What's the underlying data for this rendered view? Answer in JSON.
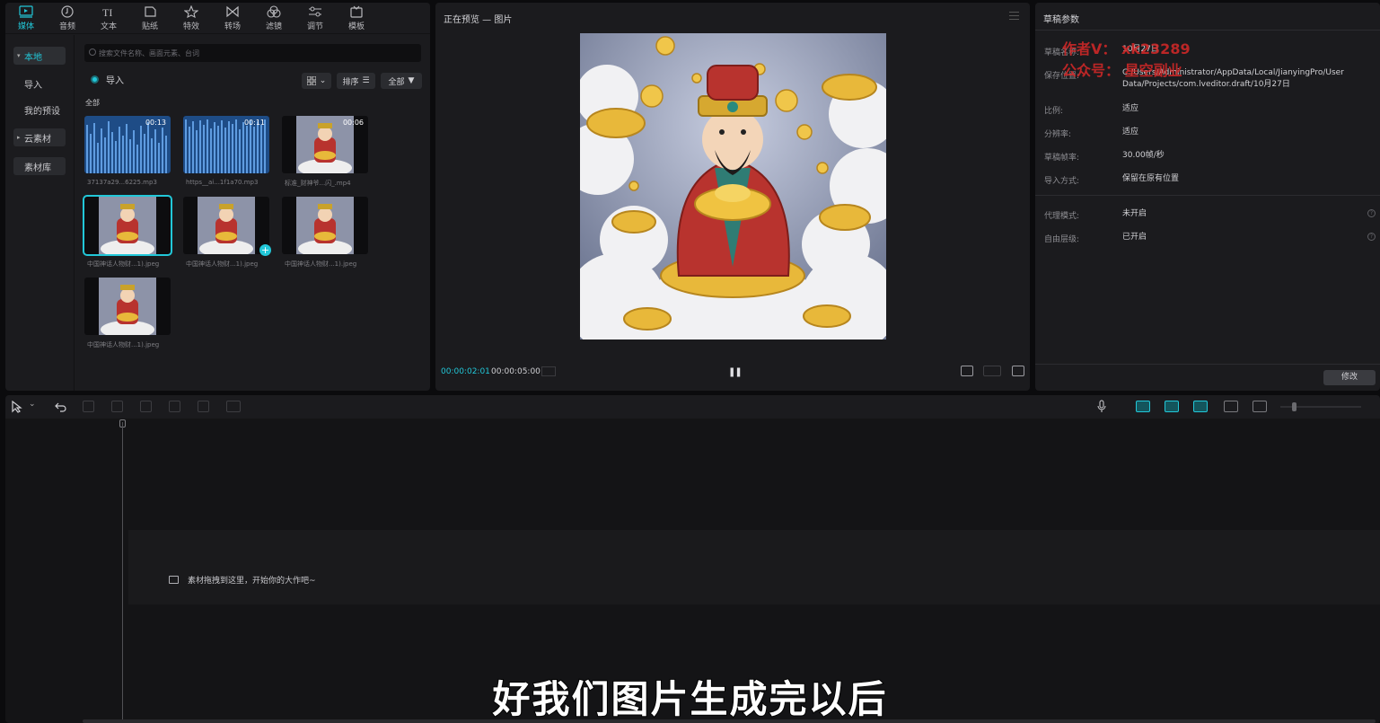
{
  "toolbar": {
    "tabs": [
      {
        "label": "媒体",
        "icon": "media-icon",
        "active": true
      },
      {
        "label": "音频",
        "icon": "audio-icon",
        "active": false
      },
      {
        "label": "文本",
        "icon": "text-icon",
        "active": false
      },
      {
        "label": "贴纸",
        "icon": "sticker-icon",
        "active": false
      },
      {
        "label": "特效",
        "icon": "effects-icon",
        "active": false
      },
      {
        "label": "转场",
        "icon": "transition-icon",
        "active": false
      },
      {
        "label": "滤镜",
        "icon": "filter-icon",
        "active": false
      },
      {
        "label": "调节",
        "icon": "adjust-icon",
        "active": false
      },
      {
        "label": "模板",
        "icon": "template-icon",
        "active": false
      }
    ]
  },
  "sidebar": {
    "items": [
      {
        "label": "本地"
      },
      {
        "label": "导入"
      },
      {
        "label": "我的预设"
      },
      {
        "label": "云素材"
      },
      {
        "label": "素材库"
      }
    ]
  },
  "media": {
    "search_placeholder": "搜索文件名称、画面元素、台词",
    "import_label": "导入",
    "view_label": "",
    "sort_label": "排序",
    "filter_label": "全部",
    "section_label": "全部",
    "items": [
      {
        "type": "audio",
        "duration": "00:13",
        "name": "37137a29...6225.mp3"
      },
      {
        "type": "audio",
        "duration": "00:11",
        "name": "https__ai...1f1a70.mp3"
      },
      {
        "type": "video",
        "duration": "00:06",
        "name": "标准_财神爷...闪_.mp4"
      },
      {
        "type": "image",
        "duration": "",
        "name": "中国神话人物财...1).jpeg"
      },
      {
        "type": "image",
        "duration": "",
        "name": "中国神话人物财...1).jpeg"
      },
      {
        "type": "image",
        "duration": "",
        "name": "中国神话人物财...1).jpeg"
      },
      {
        "type": "image",
        "duration": "",
        "name": "中国神话人物财...1).jpeg"
      }
    ]
  },
  "preview": {
    "title": "正在预览 — 图片",
    "time_current": "00:00:02:01",
    "time_total": "00:00:05:00"
  },
  "props": {
    "title": "草稿参数",
    "rows": [
      {
        "label": "草稿名称:",
        "value": "10月27日"
      },
      {
        "label": "保存位置:",
        "value": "C:/Users/Administrator/AppData/Local/JianyingPro/User Data/Projects/com.lveditor.draft/10月27日"
      },
      {
        "label": "比例:",
        "value": "适应"
      },
      {
        "label": "分辨率:",
        "value": "适应"
      },
      {
        "label": "草稿帧率:",
        "value": "30.00帧/秒"
      },
      {
        "label": "导入方式:",
        "value": "保留在原有位置"
      },
      {
        "label": "代理模式:",
        "value": "未开启"
      },
      {
        "label": "自由层级:",
        "value": "已开启"
      }
    ],
    "watermark_1": "作者V：  xk23289",
    "watermark_2": "公众号：  星空副业",
    "edit_label": "修改"
  },
  "timeline": {
    "drop_hint": "素材拖拽到这里，开始你的大作吧~"
  },
  "subtitle": "好我们图片生成完以后",
  "colors": {
    "accent": "#22c7d8",
    "panel": "#1b1b1e",
    "background": "#0b0b0d"
  }
}
